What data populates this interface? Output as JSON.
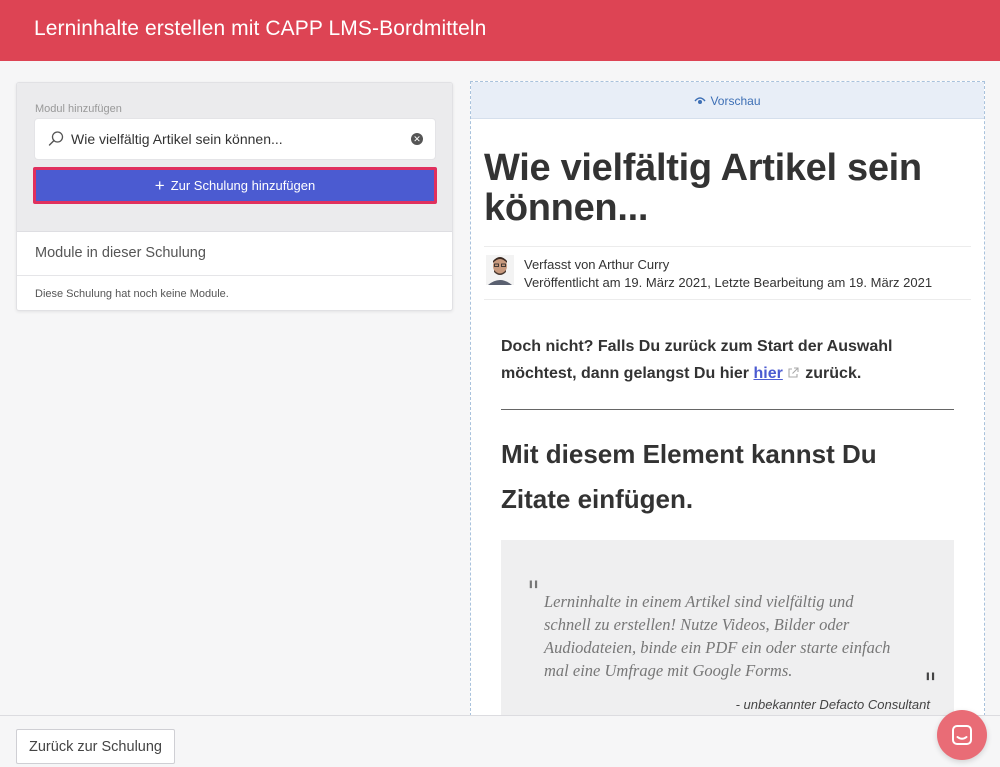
{
  "header": {
    "title": "Lerninhalte erstellen mit CAPP LMS-Bordmitteln"
  },
  "colors": {
    "brand": "#dd4454",
    "primary_button": "#4b5bd1",
    "highlight_border": "#e0305e",
    "link": "#4b5bd1",
    "chat": "#e96c76"
  },
  "add_module": {
    "label": "Modul hinzufügen",
    "search_value": "Wie vielfältig Artikel sein können...",
    "search_icon": "search-icon",
    "clear_icon": "clear-icon",
    "add_button_label": "Zur Schulung hinzufügen"
  },
  "modules": {
    "heading": "Module in dieser Schulung",
    "empty_text": "Diese Schulung hat noch keine Module."
  },
  "preview": {
    "bar_label": "Vorschau",
    "title": "Wie vielfältig Artikel sein können...",
    "author": "Verfasst von Arthur Curry",
    "dates": "Veröffentlicht am 19. März 2021, Letzte Bearbeitung am 19. März 2021",
    "back_text_before": "Doch nicht? Falls Du zurück zum Start der Auswahl möchtest, dann gelangst Du hier ",
    "back_link": "hier",
    "back_text_after": " zurück.",
    "heading2": "Mit diesem Element kannst Du Zitate einfügen.",
    "quote_text": "Lerninhalte in einem Artikel sind vielfältig und schnell zu erstellen! Nutze Videos, Bilder oder Audiodateien, binde ein PDF ein oder starte einfach mal eine Umfrage mit Google Forms.",
    "quote_author": "- unbekannter Defacto Consultant"
  },
  "footer": {
    "back_button_label": "Zurück zur Schulung"
  }
}
